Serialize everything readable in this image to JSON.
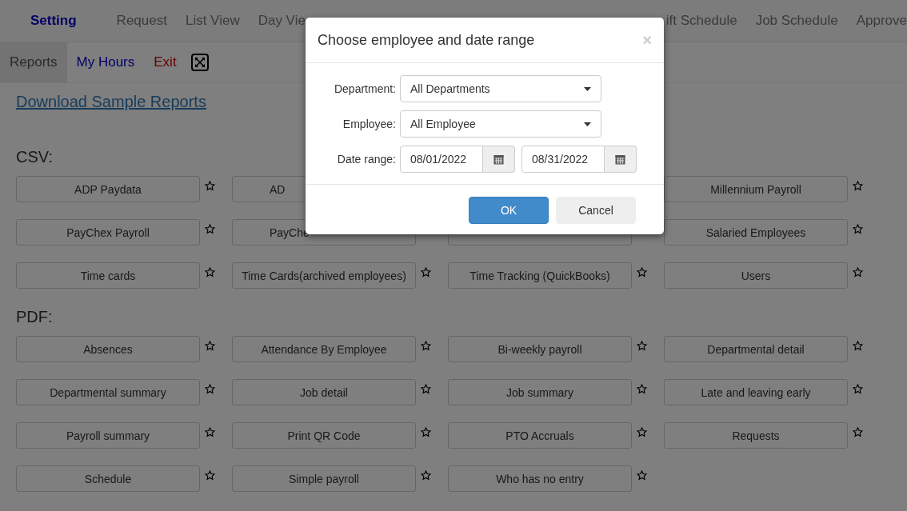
{
  "top_nav": [
    {
      "label": "Setting",
      "selected": true
    },
    {
      "label": "Request",
      "selected": false
    },
    {
      "label": "List View",
      "selected": false
    },
    {
      "label": "Day Vie",
      "selected": false
    },
    {
      "label": "ift Schedule",
      "selected": false
    },
    {
      "label": "Job Schedule",
      "selected": false
    },
    {
      "label": "Approve",
      "selected": false
    }
  ],
  "sub_nav": [
    {
      "label": "Reports",
      "kind": "tab",
      "selected": true
    },
    {
      "label": "My Hours",
      "kind": "link",
      "selected": false
    },
    {
      "label": "Exit",
      "kind": "danger",
      "selected": false
    },
    {
      "kind": "fullscreen"
    }
  ],
  "download_link": "Download Sample Reports",
  "sections": [
    {
      "title": "CSV:",
      "reports": [
        {
          "label": "ADP Paydata"
        },
        {
          "label": "AD",
          "kind": "cut"
        },
        {
          "kind": "covered"
        },
        {
          "label": "Millennium Payroll"
        },
        {
          "label": "PayChex Payroll"
        },
        {
          "label": "PayChe",
          "kind": "cut"
        },
        {
          "kind": "blank"
        },
        {
          "label": "Salaried Employees"
        },
        {
          "label": "Time cards"
        },
        {
          "label": "Time Cards(archived employees)"
        },
        {
          "label": "Time Tracking (QuickBooks)"
        },
        {
          "label": "Users"
        }
      ]
    },
    {
      "title": "PDF:",
      "reports": [
        {
          "label": "Absences"
        },
        {
          "label": "Attendance By Employee"
        },
        {
          "label": "Bi-weekly payroll"
        },
        {
          "label": "Departmental detail"
        },
        {
          "label": "Departmental summary"
        },
        {
          "label": "Job detail"
        },
        {
          "label": "Job summary"
        },
        {
          "label": "Late and leaving early"
        },
        {
          "label": "Payroll summary"
        },
        {
          "label": "Print QR Code"
        },
        {
          "label": "PTO Accruals"
        },
        {
          "label": "Requests"
        },
        {
          "label": "Schedule"
        },
        {
          "label": "Simple payroll"
        },
        {
          "label": "Who has no entry"
        }
      ]
    }
  ],
  "dialog": {
    "title": "Choose employee and date range",
    "close": "×",
    "department": {
      "label": "Department:",
      "value": "All Departments"
    },
    "employee": {
      "label": "Employee:",
      "value": "All Employee"
    },
    "date_range": {
      "label": "Date range:",
      "from": "08/01/2022",
      "to": "08/31/2022"
    },
    "buttons": [
      {
        "label": "OK",
        "kind": "primary"
      },
      {
        "label": "Cancel",
        "kind": "default"
      }
    ]
  }
}
